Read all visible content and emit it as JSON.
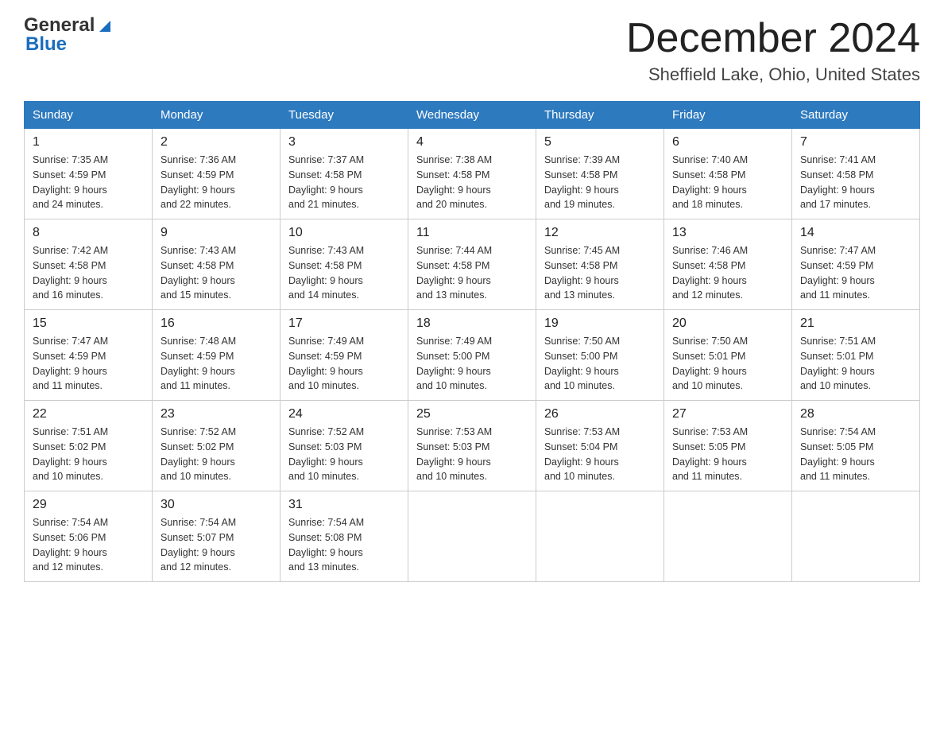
{
  "header": {
    "month_title": "December 2024",
    "location": "Sheffield Lake, Ohio, United States",
    "logo_general": "General",
    "logo_blue": "Blue"
  },
  "days_of_week": [
    "Sunday",
    "Monday",
    "Tuesday",
    "Wednesday",
    "Thursday",
    "Friday",
    "Saturday"
  ],
  "weeks": [
    [
      {
        "day": "1",
        "sunrise": "7:35 AM",
        "sunset": "4:59 PM",
        "daylight": "9 hours and 24 minutes."
      },
      {
        "day": "2",
        "sunrise": "7:36 AM",
        "sunset": "4:59 PM",
        "daylight": "9 hours and 22 minutes."
      },
      {
        "day": "3",
        "sunrise": "7:37 AM",
        "sunset": "4:58 PM",
        "daylight": "9 hours and 21 minutes."
      },
      {
        "day": "4",
        "sunrise": "7:38 AM",
        "sunset": "4:58 PM",
        "daylight": "9 hours and 20 minutes."
      },
      {
        "day": "5",
        "sunrise": "7:39 AM",
        "sunset": "4:58 PM",
        "daylight": "9 hours and 19 minutes."
      },
      {
        "day": "6",
        "sunrise": "7:40 AM",
        "sunset": "4:58 PM",
        "daylight": "9 hours and 18 minutes."
      },
      {
        "day": "7",
        "sunrise": "7:41 AM",
        "sunset": "4:58 PM",
        "daylight": "9 hours and 17 minutes."
      }
    ],
    [
      {
        "day": "8",
        "sunrise": "7:42 AM",
        "sunset": "4:58 PM",
        "daylight": "9 hours and 16 minutes."
      },
      {
        "day": "9",
        "sunrise": "7:43 AM",
        "sunset": "4:58 PM",
        "daylight": "9 hours and 15 minutes."
      },
      {
        "day": "10",
        "sunrise": "7:43 AM",
        "sunset": "4:58 PM",
        "daylight": "9 hours and 14 minutes."
      },
      {
        "day": "11",
        "sunrise": "7:44 AM",
        "sunset": "4:58 PM",
        "daylight": "9 hours and 13 minutes."
      },
      {
        "day": "12",
        "sunrise": "7:45 AM",
        "sunset": "4:58 PM",
        "daylight": "9 hours and 13 minutes."
      },
      {
        "day": "13",
        "sunrise": "7:46 AM",
        "sunset": "4:58 PM",
        "daylight": "9 hours and 12 minutes."
      },
      {
        "day": "14",
        "sunrise": "7:47 AM",
        "sunset": "4:59 PM",
        "daylight": "9 hours and 11 minutes."
      }
    ],
    [
      {
        "day": "15",
        "sunrise": "7:47 AM",
        "sunset": "4:59 PM",
        "daylight": "9 hours and 11 minutes."
      },
      {
        "day": "16",
        "sunrise": "7:48 AM",
        "sunset": "4:59 PM",
        "daylight": "9 hours and 11 minutes."
      },
      {
        "day": "17",
        "sunrise": "7:49 AM",
        "sunset": "4:59 PM",
        "daylight": "9 hours and 10 minutes."
      },
      {
        "day": "18",
        "sunrise": "7:49 AM",
        "sunset": "5:00 PM",
        "daylight": "9 hours and 10 minutes."
      },
      {
        "day": "19",
        "sunrise": "7:50 AM",
        "sunset": "5:00 PM",
        "daylight": "9 hours and 10 minutes."
      },
      {
        "day": "20",
        "sunrise": "7:50 AM",
        "sunset": "5:01 PM",
        "daylight": "9 hours and 10 minutes."
      },
      {
        "day": "21",
        "sunrise": "7:51 AM",
        "sunset": "5:01 PM",
        "daylight": "9 hours and 10 minutes."
      }
    ],
    [
      {
        "day": "22",
        "sunrise": "7:51 AM",
        "sunset": "5:02 PM",
        "daylight": "9 hours and 10 minutes."
      },
      {
        "day": "23",
        "sunrise": "7:52 AM",
        "sunset": "5:02 PM",
        "daylight": "9 hours and 10 minutes."
      },
      {
        "day": "24",
        "sunrise": "7:52 AM",
        "sunset": "5:03 PM",
        "daylight": "9 hours and 10 minutes."
      },
      {
        "day": "25",
        "sunrise": "7:53 AM",
        "sunset": "5:03 PM",
        "daylight": "9 hours and 10 minutes."
      },
      {
        "day": "26",
        "sunrise": "7:53 AM",
        "sunset": "5:04 PM",
        "daylight": "9 hours and 10 minutes."
      },
      {
        "day": "27",
        "sunrise": "7:53 AM",
        "sunset": "5:05 PM",
        "daylight": "9 hours and 11 minutes."
      },
      {
        "day": "28",
        "sunrise": "7:54 AM",
        "sunset": "5:05 PM",
        "daylight": "9 hours and 11 minutes."
      }
    ],
    [
      {
        "day": "29",
        "sunrise": "7:54 AM",
        "sunset": "5:06 PM",
        "daylight": "9 hours and 12 minutes."
      },
      {
        "day": "30",
        "sunrise": "7:54 AM",
        "sunset": "5:07 PM",
        "daylight": "9 hours and 12 minutes."
      },
      {
        "day": "31",
        "sunrise": "7:54 AM",
        "sunset": "5:08 PM",
        "daylight": "9 hours and 13 minutes."
      },
      {
        "day": "",
        "sunrise": "",
        "sunset": "",
        "daylight": ""
      },
      {
        "day": "",
        "sunrise": "",
        "sunset": "",
        "daylight": ""
      },
      {
        "day": "",
        "sunrise": "",
        "sunset": "",
        "daylight": ""
      },
      {
        "day": "",
        "sunrise": "",
        "sunset": "",
        "daylight": ""
      }
    ]
  ],
  "labels": {
    "sunrise": "Sunrise:",
    "sunset": "Sunset:",
    "daylight": "Daylight:"
  }
}
